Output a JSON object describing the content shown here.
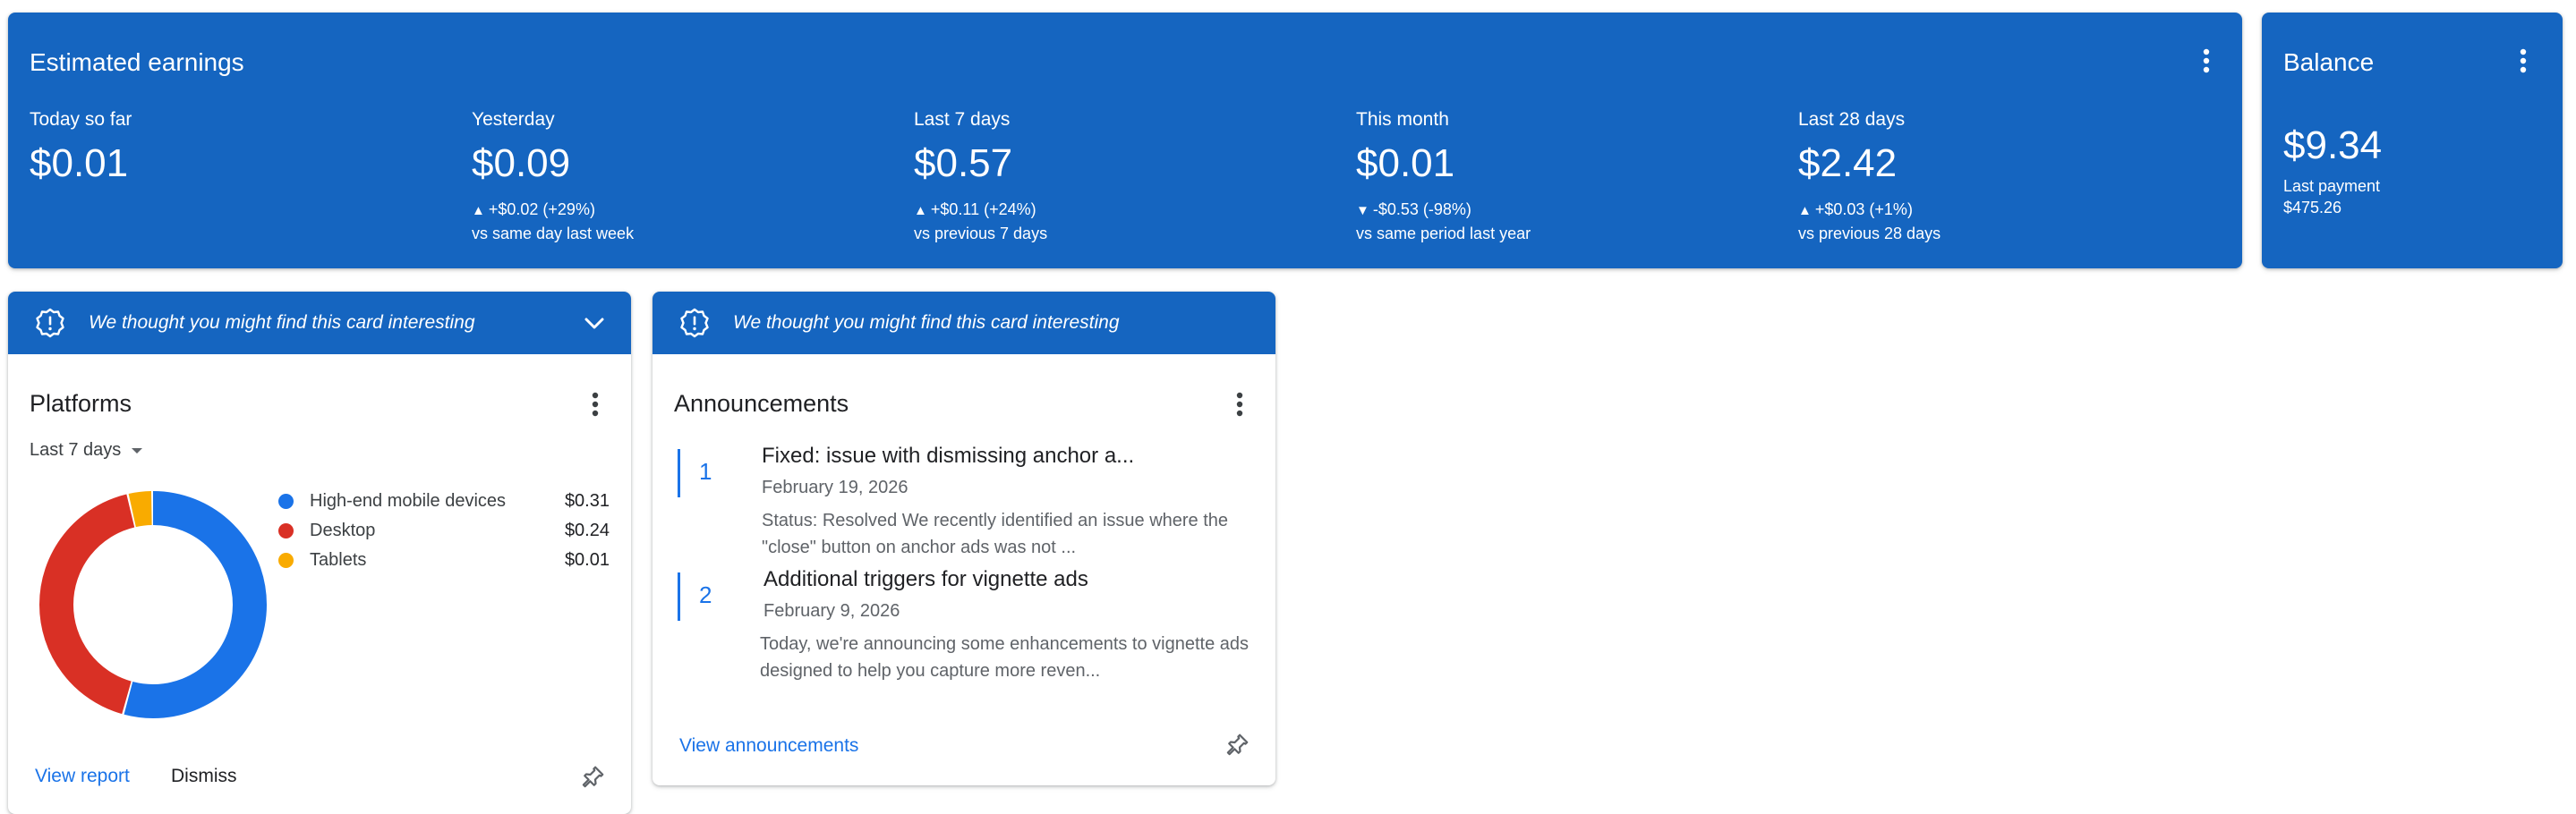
{
  "earnings": {
    "title": "Estimated earnings",
    "stats": [
      {
        "label": "Today so far",
        "value": "$0.01",
        "change": "",
        "compare": ""
      },
      {
        "label": "Yesterday",
        "value": "$0.09",
        "arrow": "▲",
        "change": "+$0.02 (+29%)",
        "compare": "vs same day last week"
      },
      {
        "label": "Last 7 days",
        "value": "$0.57",
        "arrow": "▲",
        "change": "+$0.11 (+24%)",
        "compare": "vs previous 7 days"
      },
      {
        "label": "This month",
        "value": "$0.01",
        "arrow": "▼",
        "change": "-$0.53 (-98%)",
        "compare": "vs same period last year"
      },
      {
        "label": "Last 28 days",
        "value": "$2.42",
        "arrow": "▲",
        "change": "+$0.03 (+1%)",
        "compare": "vs previous 28 days"
      }
    ]
  },
  "balance": {
    "title": "Balance",
    "value": "$9.34",
    "last_payment_label": "Last payment",
    "last_payment_value": "$475.26"
  },
  "platforms": {
    "banner": "We thought you might find this card interesting",
    "title": "Platforms",
    "range": "Last 7 days",
    "items": [
      {
        "name": "High-end mobile devices",
        "value": "$0.31",
        "color": "#1a73e8",
        "share": 0.5439
      },
      {
        "name": "Desktop",
        "value": "$0.24",
        "color": "#d93025",
        "share": 0.4211
      },
      {
        "name": "Tablets",
        "value": "$0.01",
        "color": "#f9ab00",
        "share": 0.035
      }
    ],
    "view_report": "View report",
    "dismiss": "Dismiss"
  },
  "announcements": {
    "banner": "We thought you might find this card interesting",
    "title": "Announcements",
    "items": [
      {
        "num": "1",
        "title": "Fixed: issue with dismissing anchor a...",
        "date": "February 19, 2026",
        "desc": "Status: Resolved We recently identified an issue where the \"close\" button on anchor ads was not ..."
      },
      {
        "num": "2",
        "title": "Additional triggers for vignette ads",
        "date": "February 9, 2026",
        "desc": "Today, we're announcing some enhancements to vignette ads designed to help you capture more reven..."
      }
    ],
    "view_all": "View announcements"
  },
  "colors": {
    "brand_blue": "#1565c0",
    "link_blue": "#1a73e8"
  }
}
